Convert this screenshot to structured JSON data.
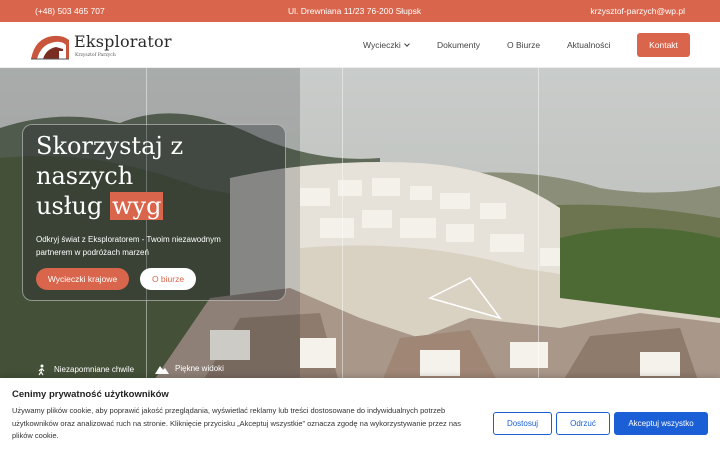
{
  "topbar": {
    "phone": "(+48) 503 465 707",
    "address": "Ul. Drewniana 11/23 76-200 Słupsk",
    "email": "krzysztof-parzych@wp.pl"
  },
  "header": {
    "logo_title": "Eksplorator",
    "logo_subtitle": "Krzysztof Parzych",
    "nav": [
      {
        "label": "Wycieczki"
      },
      {
        "label": "Dokumenty"
      },
      {
        "label": "O Biurze"
      },
      {
        "label": "Aktualności"
      }
    ],
    "cta_label": "Kontakt"
  },
  "hero": {
    "headline_1": "Skorzystaj z",
    "headline_2": "naszych",
    "headline_3": "usług ",
    "headline_accent": "wyg",
    "lead": "Odkryj świat z Eksploratorem - Twoim niezawodnym partnerem w podróżach marzeń",
    "btn_primary": "Wycieczki krajowe",
    "btn_secondary": "O biurze",
    "features": [
      {
        "icon": "hiker-icon",
        "label": "Niezapomniane chwile"
      },
      {
        "icon": "mountain-icon",
        "label": "Piękne widoki"
      }
    ]
  },
  "cookie": {
    "title": "Cenimy prywatność użytkowników",
    "text": "Używamy plików cookie, aby poprawić jakość przeglądania, wyświetlać reklamy lub treści dostosowane do indywidualnych potrzeb użytkowników oraz analizować ruch na stronie. Kliknięcie przycisku „Akceptuj wszystkie” oznacza zgodę na wykorzystywanie przez nas plików cookie.",
    "btn_customize": "Dostosuj",
    "btn_reject": "Odrzuć",
    "btn_accept": "Akceptuj wszystko"
  },
  "colors": {
    "accent": "#d9664c",
    "cookie_blue": "#1a5fd6"
  }
}
